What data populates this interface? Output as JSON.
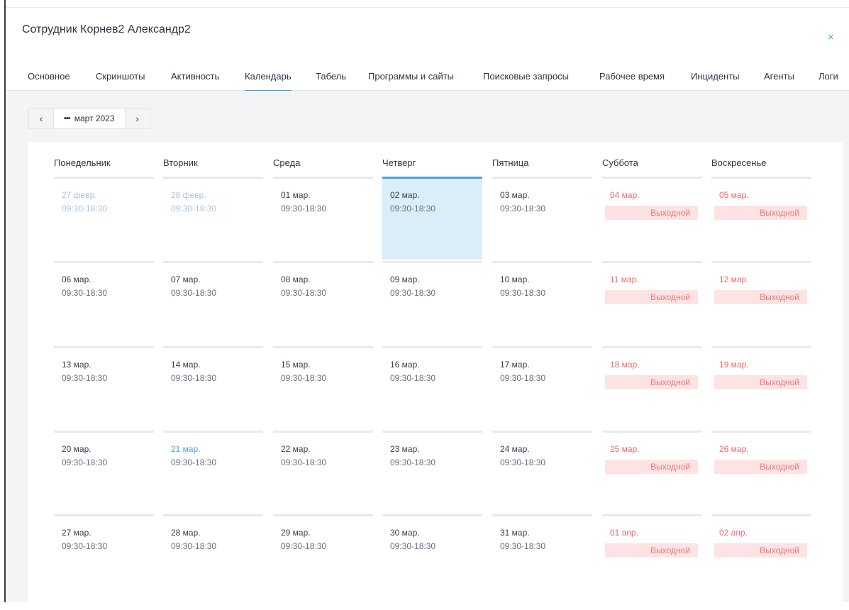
{
  "window": {
    "title": "Сотрудник Корнев2 Александр2",
    "close_symbol": "×"
  },
  "tabs": [
    {
      "label": "Основное"
    },
    {
      "label": "Скриншоты"
    },
    {
      "label": "Активность"
    },
    {
      "label": "Календарь",
      "active": true
    },
    {
      "label": "Табель"
    },
    {
      "label": "Программы и сайты"
    },
    {
      "label": "Поисковые запросы"
    },
    {
      "label": "Рабочее время"
    },
    {
      "label": "Инциденты"
    },
    {
      "label": "Агенты"
    },
    {
      "label": "Логи"
    }
  ],
  "month_nav": {
    "prev": "‹",
    "next": "›",
    "icon": "calendar-icon",
    "label": "март 2023"
  },
  "weekdays": [
    "Понедельник",
    "Вторник",
    "Среда",
    "Четверг",
    "Пятница",
    "Суббота",
    "Воскресенье"
  ],
  "dayoff_label": "Выходной",
  "weeks": [
    [
      {
        "date": "27 февр.",
        "hours": "09:30-18:30",
        "state": "faded"
      },
      {
        "date": "28 февр.",
        "hours": "09:30-18:30",
        "state": "faded"
      },
      {
        "date": "01 мар.",
        "hours": "09:30-18:30"
      },
      {
        "date": "02 мар.",
        "hours": "09:30-18:30",
        "state": "today"
      },
      {
        "date": "03 мар.",
        "hours": "09:30-18:30"
      },
      {
        "date": "04 мар.",
        "state": "weekend"
      },
      {
        "date": "05 мар.",
        "state": "weekend"
      }
    ],
    [
      {
        "date": "06 мар.",
        "hours": "09:30-18:30"
      },
      {
        "date": "07 мар.",
        "hours": "09:30-18:30"
      },
      {
        "date": "08 мар.",
        "hours": "09:30-18:30"
      },
      {
        "date": "09 мар.",
        "hours": "09:30-18:30"
      },
      {
        "date": "10 мар.",
        "hours": "09:30-18:30"
      },
      {
        "date": "11 мар.",
        "state": "weekend"
      },
      {
        "date": "12 мар.",
        "state": "weekend"
      }
    ],
    [
      {
        "date": "13 мар.",
        "hours": "09:30-18:30"
      },
      {
        "date": "14 мар.",
        "hours": "09:30-18:30"
      },
      {
        "date": "15 мар.",
        "hours": "09:30-18:30"
      },
      {
        "date": "16 мар.",
        "hours": "09:30-18:30"
      },
      {
        "date": "17 мар.",
        "hours": "09:30-18:30"
      },
      {
        "date": "18 мар.",
        "state": "weekend"
      },
      {
        "date": "19 мар.",
        "state": "weekend"
      }
    ],
    [
      {
        "date": "20 мар.",
        "hours": "09:30-18:30"
      },
      {
        "date": "21 мар.",
        "hours": "09:30-18:30",
        "state": "current"
      },
      {
        "date": "22 мар.",
        "hours": "09:30-18:30"
      },
      {
        "date": "23 мар.",
        "hours": "09:30-18:30"
      },
      {
        "date": "24 мар.",
        "hours": "09:30-18:30"
      },
      {
        "date": "25 мар.",
        "state": "weekend"
      },
      {
        "date": "26 мар.",
        "state": "weekend"
      }
    ],
    [
      {
        "date": "27 мар.",
        "hours": "09:30-18:30"
      },
      {
        "date": "28 мар.",
        "hours": "09:30-18:30"
      },
      {
        "date": "29 мар.",
        "hours": "09:30-18:30"
      },
      {
        "date": "30 мар.",
        "hours": "09:30-18:30"
      },
      {
        "date": "31 мар.",
        "hours": "09:30-18:30"
      },
      {
        "date": "01 апр.",
        "state": "weekend"
      },
      {
        "date": "02 апр.",
        "state": "weekend"
      }
    ]
  ],
  "colors": {
    "accent": "#4aa3e0",
    "today_bg": "#daeefa",
    "weekend_text": "#f06a6a",
    "dayoff_bg": "#fde3e3"
  }
}
